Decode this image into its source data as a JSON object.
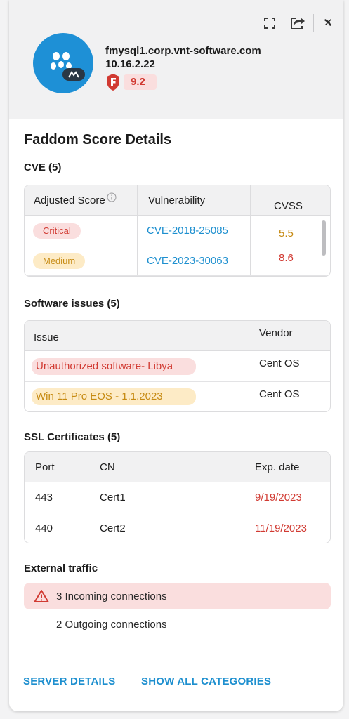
{
  "header": {
    "hostname": "fmysql1.corp.vnt-software.com",
    "ip": "10.16.2.22",
    "score": "9.2",
    "toolbar": {
      "expand_icon": "expand-icon",
      "share_icon": "share-icon",
      "pin_icon": "pin-icon"
    },
    "colors": {
      "avatar": "#1e90d6",
      "score": "#d13a32"
    }
  },
  "title": "Faddom Score Details",
  "cve": {
    "title": "CVE (5)",
    "columns": [
      "Adjusted Score",
      "Vulnerability",
      "CVSS"
    ],
    "rows": [
      {
        "adjusted": "Critical",
        "vulnerability": "CVE-2018-25085",
        "cvss": "5.5"
      },
      {
        "adjusted": "Medium",
        "vulnerability": "CVE-2023-30063",
        "cvss": "8.6"
      }
    ]
  },
  "software": {
    "title": "Software issues (5)",
    "columns": [
      "Issue",
      "Vendor"
    ],
    "rows": [
      {
        "issue": "Unauthorized software- Libya",
        "vendor": "Cent OS"
      },
      {
        "issue": "Win 11 Pro EOS - 1.1.2023",
        "vendor": "Cent OS"
      }
    ]
  },
  "ssl": {
    "title": "SSL Certificates (5)",
    "columns": [
      "Port",
      "CN",
      "Exp. date"
    ],
    "rows": [
      {
        "port": "443",
        "cn": "Cert1",
        "exp": "9/19/2023"
      },
      {
        "port": "440",
        "cn": "Cert2",
        "exp": "11/19/2023"
      }
    ]
  },
  "traffic": {
    "title": "External traffic",
    "incoming": "3 Incoming connections",
    "outgoing": "2 Outgoing connections"
  },
  "footer": {
    "server_details": "SERVER DETAILS",
    "show_all": "SHOW ALL CATEGORIES"
  }
}
